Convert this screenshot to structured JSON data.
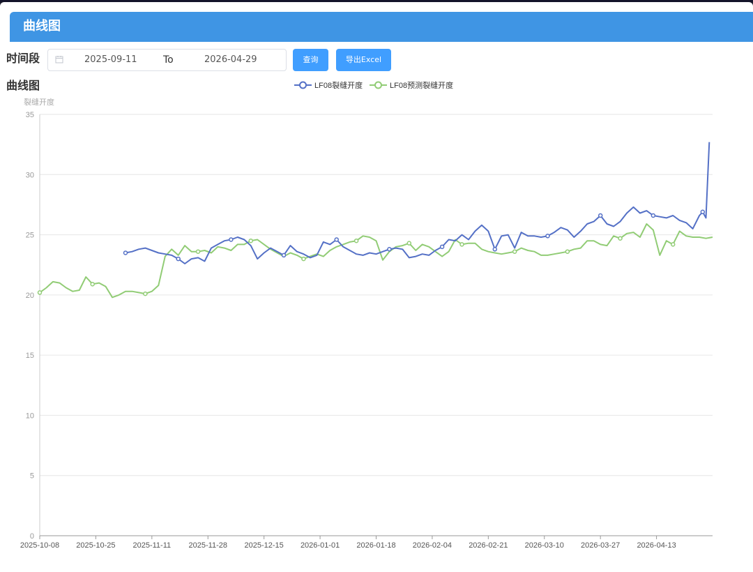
{
  "header": {
    "title": "曲线图"
  },
  "filter": {
    "label": "时间段",
    "start_date": "2025-09-11",
    "separator": "To",
    "end_date": "2026-04-29",
    "query_label": "查询",
    "export_label": "导出Excel"
  },
  "chart_section": {
    "title": "曲线图"
  },
  "colors": {
    "header": "#3f95e4",
    "button": "#409eff"
  },
  "chart_data": {
    "type": "line",
    "ylabel": "裂缝开度",
    "ylim": [
      0,
      35
    ],
    "yticks": [
      0,
      5,
      10,
      15,
      20,
      25,
      30,
      35
    ],
    "grid": true,
    "legend": "top",
    "x_start": "2025-10-08",
    "x_end": "2026-04-30",
    "xticks": [
      "2025-10-08",
      "2025-10-25",
      "2025-11-11",
      "2025-11-28",
      "2025-12-15",
      "2026-01-01",
      "2026-01-18",
      "2026-02-04",
      "2026-02-21",
      "2026-03-10",
      "2026-03-27",
      "2026-04-13"
    ],
    "series": [
      {
        "name": "LF08裂缝开度",
        "color": "#5470c6",
        "points": [
          [
            "2025-11-03",
            23.5
          ],
          [
            "2025-11-05",
            23.6
          ],
          [
            "2025-11-07",
            23.8
          ],
          [
            "2025-11-09",
            23.9
          ],
          [
            "2025-11-11",
            23.7
          ],
          [
            "2025-11-13",
            23.5
          ],
          [
            "2025-11-15",
            23.4
          ],
          [
            "2025-11-17",
            23.3
          ],
          [
            "2025-11-19",
            23.0
          ],
          [
            "2025-11-21",
            22.6
          ],
          [
            "2025-11-23",
            23.0
          ],
          [
            "2025-11-25",
            23.1
          ],
          [
            "2025-11-27",
            22.8
          ],
          [
            "2025-11-29",
            23.9
          ],
          [
            "2025-12-01",
            24.2
          ],
          [
            "2025-12-03",
            24.5
          ],
          [
            "2025-12-05",
            24.6
          ],
          [
            "2025-12-07",
            24.8
          ],
          [
            "2025-12-09",
            24.6
          ],
          [
            "2025-12-11",
            24.1
          ],
          [
            "2025-12-13",
            23.0
          ],
          [
            "2025-12-15",
            23.5
          ],
          [
            "2025-12-17",
            23.9
          ],
          [
            "2025-12-19",
            23.6
          ],
          [
            "2025-12-21",
            23.3
          ],
          [
            "2025-12-23",
            24.1
          ],
          [
            "2025-12-25",
            23.6
          ],
          [
            "2025-12-27",
            23.4
          ],
          [
            "2025-12-29",
            23.1
          ],
          [
            "2025-12-31",
            23.3
          ],
          [
            "2026-01-02",
            24.4
          ],
          [
            "2026-01-04",
            24.2
          ],
          [
            "2026-01-06",
            24.6
          ],
          [
            "2026-01-08",
            24.0
          ],
          [
            "2026-01-10",
            23.7
          ],
          [
            "2026-01-12",
            23.4
          ],
          [
            "2026-01-14",
            23.3
          ],
          [
            "2026-01-16",
            23.5
          ],
          [
            "2026-01-18",
            23.4
          ],
          [
            "2026-01-20",
            23.6
          ],
          [
            "2026-01-22",
            23.8
          ],
          [
            "2026-01-24",
            23.9
          ],
          [
            "2026-01-26",
            23.8
          ],
          [
            "2026-01-28",
            23.1
          ],
          [
            "2026-01-30",
            23.2
          ],
          [
            "2026-02-01",
            23.4
          ],
          [
            "2026-02-03",
            23.3
          ],
          [
            "2026-02-05",
            23.7
          ],
          [
            "2026-02-07",
            24.0
          ],
          [
            "2026-02-09",
            24.6
          ],
          [
            "2026-02-11",
            24.5
          ],
          [
            "2026-02-13",
            25.0
          ],
          [
            "2026-02-15",
            24.6
          ],
          [
            "2026-02-17",
            25.3
          ],
          [
            "2026-02-19",
            25.8
          ],
          [
            "2026-02-21",
            25.3
          ],
          [
            "2026-02-23",
            23.8
          ],
          [
            "2026-02-25",
            24.9
          ],
          [
            "2026-02-27",
            25.0
          ],
          [
            "2026-03-01",
            23.9
          ],
          [
            "2026-03-03",
            25.2
          ],
          [
            "2026-03-05",
            24.9
          ],
          [
            "2026-03-07",
            24.9
          ],
          [
            "2026-03-09",
            24.8
          ],
          [
            "2026-03-11",
            24.9
          ],
          [
            "2026-03-13",
            25.2
          ],
          [
            "2026-03-15",
            25.6
          ],
          [
            "2026-03-17",
            25.4
          ],
          [
            "2026-03-19",
            24.8
          ],
          [
            "2026-03-21",
            25.3
          ],
          [
            "2026-03-23",
            25.9
          ],
          [
            "2026-03-25",
            26.1
          ],
          [
            "2026-03-27",
            26.6
          ],
          [
            "2026-03-29",
            25.9
          ],
          [
            "2026-03-31",
            25.7
          ],
          [
            "2026-04-02",
            26.1
          ],
          [
            "2026-04-04",
            26.8
          ],
          [
            "2026-04-06",
            27.3
          ],
          [
            "2026-04-08",
            26.8
          ],
          [
            "2026-04-10",
            27.0
          ],
          [
            "2026-04-12",
            26.6
          ],
          [
            "2026-04-14",
            26.5
          ],
          [
            "2026-04-16",
            26.4
          ],
          [
            "2026-04-18",
            26.6
          ],
          [
            "2026-04-20",
            26.2
          ],
          [
            "2026-04-22",
            26.0
          ],
          [
            "2026-04-24",
            25.5
          ],
          [
            "2026-04-26",
            26.6
          ],
          [
            "2026-04-27",
            26.9
          ],
          [
            "2026-04-28",
            26.4
          ],
          [
            "2026-04-29",
            32.7
          ]
        ]
      },
      {
        "name": "LF08预测裂缝开度",
        "color": "#91cc75",
        "points": [
          [
            "2025-10-08",
            20.2
          ],
          [
            "2025-10-10",
            20.6
          ],
          [
            "2025-10-12",
            21.1
          ],
          [
            "2025-10-14",
            21.0
          ],
          [
            "2025-10-16",
            20.6
          ],
          [
            "2025-10-18",
            20.3
          ],
          [
            "2025-10-20",
            20.4
          ],
          [
            "2025-10-22",
            21.5
          ],
          [
            "2025-10-24",
            20.9
          ],
          [
            "2025-10-26",
            21.0
          ],
          [
            "2025-10-28",
            20.7
          ],
          [
            "2025-10-30",
            19.8
          ],
          [
            "2025-11-01",
            20.0
          ],
          [
            "2025-11-03",
            20.3
          ],
          [
            "2025-11-05",
            20.3
          ],
          [
            "2025-11-07",
            20.2
          ],
          [
            "2025-11-09",
            20.1
          ],
          [
            "2025-11-11",
            20.3
          ],
          [
            "2025-11-13",
            20.8
          ],
          [
            "2025-11-15",
            23.2
          ],
          [
            "2025-11-17",
            23.8
          ],
          [
            "2025-11-19",
            23.3
          ],
          [
            "2025-11-21",
            24.1
          ],
          [
            "2025-11-23",
            23.6
          ],
          [
            "2025-11-25",
            23.6
          ],
          [
            "2025-11-27",
            23.7
          ],
          [
            "2025-11-29",
            23.5
          ],
          [
            "2025-12-01",
            24.0
          ],
          [
            "2025-12-03",
            23.9
          ],
          [
            "2025-12-05",
            23.7
          ],
          [
            "2025-12-07",
            24.2
          ],
          [
            "2025-12-09",
            24.2
          ],
          [
            "2025-12-11",
            24.5
          ],
          [
            "2025-12-13",
            24.6
          ],
          [
            "2025-12-15",
            24.2
          ],
          [
            "2025-12-17",
            23.8
          ],
          [
            "2025-12-19",
            23.5
          ],
          [
            "2025-12-21",
            23.2
          ],
          [
            "2025-12-23",
            23.5
          ],
          [
            "2025-12-25",
            23.3
          ],
          [
            "2025-12-27",
            23.0
          ],
          [
            "2025-12-29",
            23.2
          ],
          [
            "2025-12-31",
            23.4
          ],
          [
            "2026-01-02",
            23.2
          ],
          [
            "2026-01-04",
            23.7
          ],
          [
            "2026-01-06",
            24.0
          ],
          [
            "2026-01-08",
            24.2
          ],
          [
            "2026-01-10",
            24.4
          ],
          [
            "2026-01-12",
            24.5
          ],
          [
            "2026-01-14",
            24.9
          ],
          [
            "2026-01-16",
            24.8
          ],
          [
            "2026-01-18",
            24.5
          ],
          [
            "2026-01-20",
            22.9
          ],
          [
            "2026-01-22",
            23.6
          ],
          [
            "2026-01-24",
            24.0
          ],
          [
            "2026-01-26",
            24.1
          ],
          [
            "2026-01-28",
            24.3
          ],
          [
            "2026-01-30",
            23.7
          ],
          [
            "2026-02-01",
            24.2
          ],
          [
            "2026-02-03",
            24.0
          ],
          [
            "2026-02-05",
            23.6
          ],
          [
            "2026-02-07",
            23.2
          ],
          [
            "2026-02-09",
            23.6
          ],
          [
            "2026-02-11",
            24.6
          ],
          [
            "2026-02-13",
            24.2
          ],
          [
            "2026-02-15",
            24.3
          ],
          [
            "2026-02-17",
            24.3
          ],
          [
            "2026-02-19",
            23.8
          ],
          [
            "2026-02-21",
            23.6
          ],
          [
            "2026-02-23",
            23.5
          ],
          [
            "2026-02-25",
            23.4
          ],
          [
            "2026-02-27",
            23.5
          ],
          [
            "2026-03-01",
            23.6
          ],
          [
            "2026-03-03",
            23.9
          ],
          [
            "2026-03-05",
            23.7
          ],
          [
            "2026-03-07",
            23.6
          ],
          [
            "2026-03-09",
            23.3
          ],
          [
            "2026-03-11",
            23.3
          ],
          [
            "2026-03-13",
            23.4
          ],
          [
            "2026-03-15",
            23.5
          ],
          [
            "2026-03-17",
            23.6
          ],
          [
            "2026-03-19",
            23.8
          ],
          [
            "2026-03-21",
            23.9
          ],
          [
            "2026-03-23",
            24.5
          ],
          [
            "2026-03-25",
            24.5
          ],
          [
            "2026-03-27",
            24.2
          ],
          [
            "2026-03-29",
            24.1
          ],
          [
            "2026-03-31",
            24.9
          ],
          [
            "2026-04-02",
            24.7
          ],
          [
            "2026-04-04",
            25.1
          ],
          [
            "2026-04-06",
            25.2
          ],
          [
            "2026-04-08",
            24.8
          ],
          [
            "2026-04-10",
            25.9
          ],
          [
            "2026-04-12",
            25.4
          ],
          [
            "2026-04-14",
            23.3
          ],
          [
            "2026-04-16",
            24.5
          ],
          [
            "2026-04-18",
            24.2
          ],
          [
            "2026-04-20",
            25.3
          ],
          [
            "2026-04-22",
            24.9
          ],
          [
            "2026-04-24",
            24.8
          ],
          [
            "2026-04-26",
            24.8
          ],
          [
            "2026-04-28",
            24.7
          ],
          [
            "2026-04-30",
            24.8
          ]
        ]
      }
    ]
  }
}
